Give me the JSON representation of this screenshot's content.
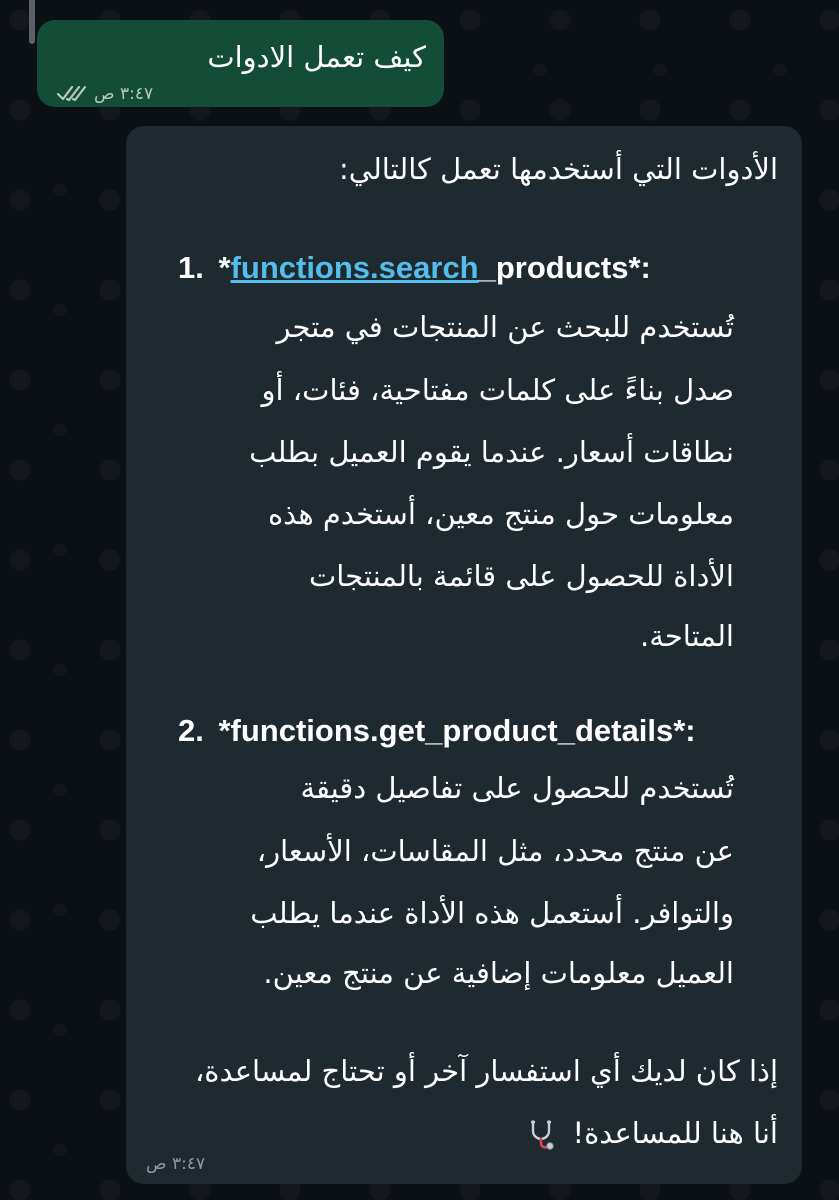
{
  "outgoing": {
    "text": "كيف تعمل الادوات",
    "time": "٣:٤٧ ص"
  },
  "incoming": {
    "intro": "الأدوات التي أستخدمها تعمل كالتالي:",
    "item1": {
      "number": "1.",
      "prefix": "*",
      "link": "functions.search",
      "rest": "_products*:",
      "lines": [
        "تُستخدم للبحث عن المنتجات في متجر",
        "صدل بناءً على كلمات مفتاحية، فئات، أو",
        "نطاقات أسعار. عندما يقوم العميل بطلب",
        "معلومات حول منتج معين، أستخدم هذه",
        "الأداة للحصول على قائمة بالمنتجات",
        "المتاحة."
      ]
    },
    "item2": {
      "number": "2.",
      "title": "*functions.get_product_details*:",
      "lines": [
        "تُستخدم للحصول على تفاصيل دقيقة",
        "عن منتج محدد، مثل المقاسات، الأسعار،",
        "والتوافر. أستعمل هذه الأداة عندما يطلب",
        "العميل معلومات إضافية عن منتج معين."
      ]
    },
    "closing": [
      "إذا كان لديك أي استفسار آخر أو تحتاج لمساعدة،",
      "أنا هنا للمساعدة!"
    ],
    "emoji": "stethoscope-icon",
    "time": "٣:٤٧ ص"
  },
  "colors": {
    "background": "#0b1014",
    "outgoing_bubble": "#134d37",
    "incoming_bubble": "#1f2a30",
    "link": "#53bdeb"
  }
}
